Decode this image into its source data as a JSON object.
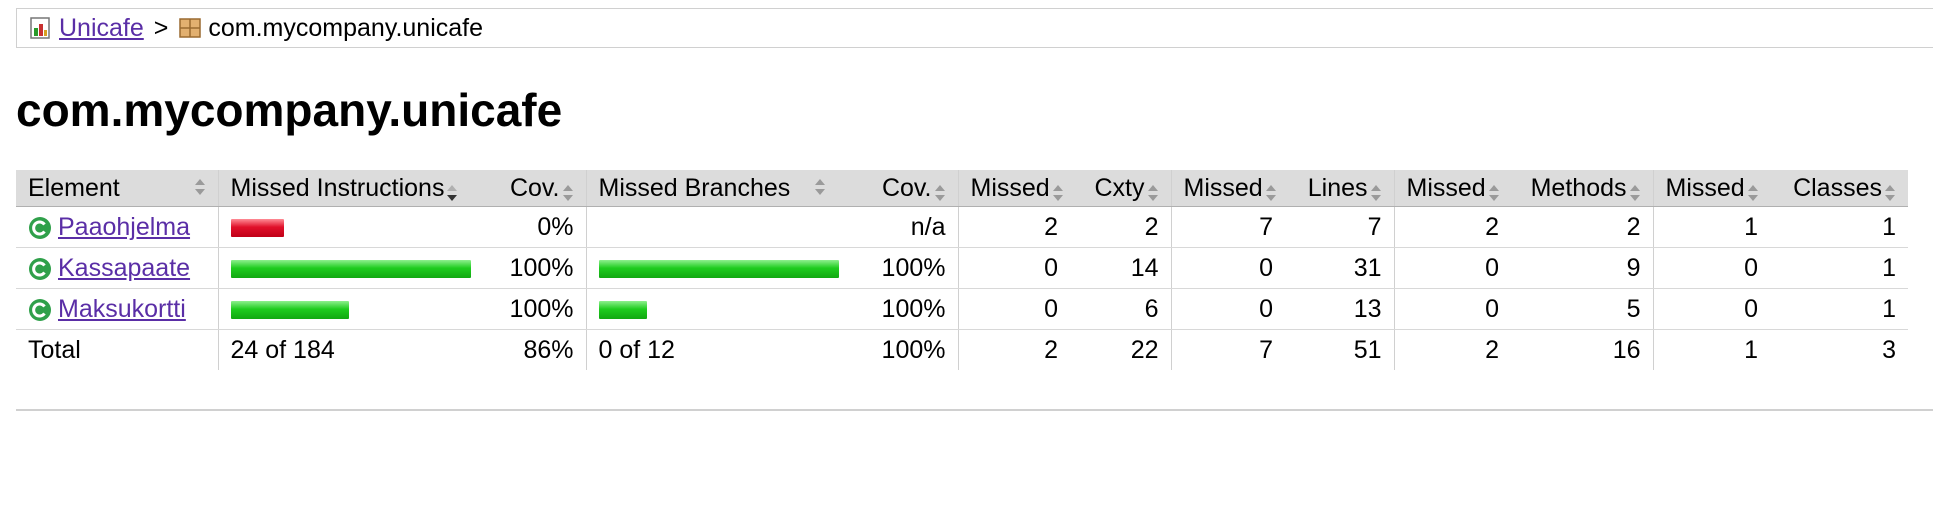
{
  "breadcrumb": {
    "root_label": "Unicafe",
    "separator": ">",
    "current_label": "com.mycompany.unicafe"
  },
  "page": {
    "title": "com.mycompany.unicafe"
  },
  "table": {
    "headers": {
      "element": "Element",
      "missed_instructions": "Missed Instructions",
      "instr_cov": "Cov.",
      "missed_branches": "Missed Branches",
      "branch_cov": "Cov.",
      "missed_cxty": "Missed",
      "cxty": "Cxty",
      "missed_lines": "Missed",
      "lines": "Lines",
      "missed_methods": "Missed",
      "methods": "Methods",
      "missed_classes": "Missed",
      "classes": "Classes"
    },
    "rows": [
      {
        "name": "Paaohjelma",
        "instr_bar_color": "red",
        "instr_bar_fraction": 0.22,
        "instr_cov": "0%",
        "branch_bar_fraction": 0,
        "branch_cov": "n/a",
        "missed_cxty": "2",
        "cxty": "2",
        "missed_lines": "7",
        "lines": "7",
        "missed_methods": "2",
        "methods": "2",
        "missed_classes": "1",
        "classes": "1"
      },
      {
        "name": "Kassapaate",
        "instr_bar_color": "green",
        "instr_bar_fraction": 1.0,
        "instr_cov": "100%",
        "branch_bar_fraction": 1.0,
        "branch_cov": "100%",
        "missed_cxty": "0",
        "cxty": "14",
        "missed_lines": "0",
        "lines": "31",
        "missed_methods": "0",
        "methods": "9",
        "missed_classes": "0",
        "classes": "1"
      },
      {
        "name": "Maksukortti",
        "instr_bar_color": "green",
        "instr_bar_fraction": 0.49,
        "instr_cov": "100%",
        "branch_bar_fraction": 0.2,
        "branch_cov": "100%",
        "missed_cxty": "0",
        "cxty": "6",
        "missed_lines": "0",
        "lines": "13",
        "missed_methods": "0",
        "methods": "5",
        "missed_classes": "0",
        "classes": "1"
      }
    ],
    "total": {
      "label": "Total",
      "instructions": "24 of 184",
      "instr_cov": "86%",
      "branches": "0 of 12",
      "branch_cov": "100%",
      "missed_cxty": "2",
      "cxty": "22",
      "missed_lines": "7",
      "lines": "51",
      "missed_methods": "2",
      "methods": "16",
      "missed_classes": "1",
      "classes": "3"
    }
  },
  "colors": {
    "link": "#5a2ea6",
    "header_bg": "#dcdcdc",
    "bar_red": "#e0102a",
    "bar_green": "#1fcc1f"
  },
  "icons": {
    "report": "report-icon",
    "package": "package-icon",
    "class": "class-icon",
    "sort": "sort-icon",
    "sort_down": "sort-down-icon"
  }
}
